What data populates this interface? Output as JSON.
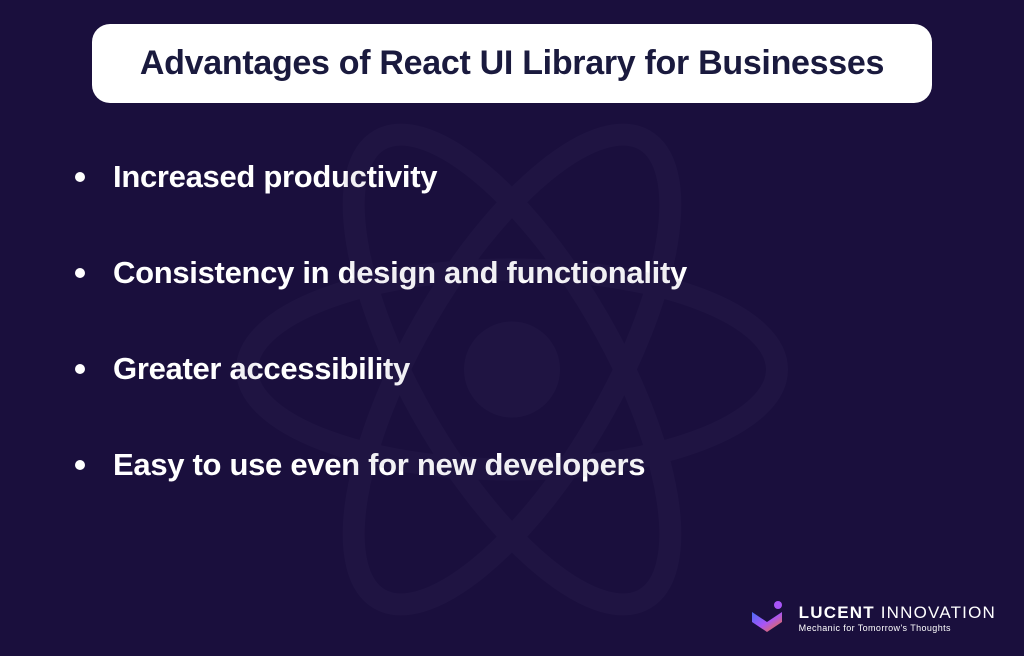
{
  "title": "Advantages of React UI Library for Businesses",
  "bullets": [
    "Increased productivity",
    "Consistency in design and functionality",
    "Greater accessibility",
    "Easy to use even for new developers"
  ],
  "footer": {
    "company_bold": "LUCENT",
    "company_light": " INNOVATION",
    "tagline": "Mechanic for Tomorrow's Thoughts"
  }
}
